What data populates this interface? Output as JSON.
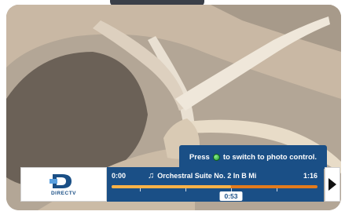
{
  "hint": {
    "prefix": "Press",
    "suffix": "to switch to photo control."
  },
  "logo": {
    "text": "DIRECTV"
  },
  "player": {
    "time_start": "0:00",
    "time_end": "1:16",
    "track_title": "Orchestral Suite No. 2 In B Mi",
    "current_time": "0:53",
    "progress": 0.58
  },
  "icons": {
    "note": "music-note-icon",
    "hint_button": "green-button-icon",
    "next": "next-arrow-icon"
  },
  "colors": {
    "panel_blue": "#1a4f86",
    "progress_orange": "#e37b1c",
    "green_button": "#1b9a2b"
  }
}
